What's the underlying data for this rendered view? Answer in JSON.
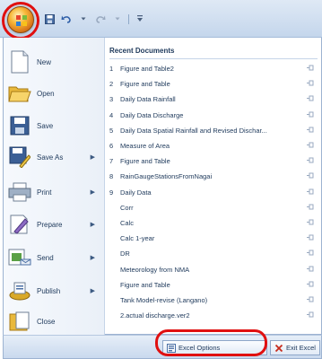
{
  "quick_access": {
    "save_icon": "save-icon",
    "undo_icon": "undo-icon",
    "redo_icon": "redo-icon",
    "customize_icon": "customize-arrow-icon"
  },
  "commands": [
    {
      "label": "New",
      "icon": "new-document-icon",
      "has_submenu": false
    },
    {
      "label": "Open",
      "icon": "open-folder-icon",
      "has_submenu": false
    },
    {
      "label": "Save",
      "icon": "save-disk-icon",
      "has_submenu": false
    },
    {
      "label": "Save As",
      "icon": "save-as-icon",
      "has_submenu": true
    },
    {
      "label": "Print",
      "icon": "printer-icon",
      "has_submenu": true
    },
    {
      "label": "Prepare",
      "icon": "prepare-icon",
      "has_submenu": true
    },
    {
      "label": "Send",
      "icon": "send-icon",
      "has_submenu": true
    },
    {
      "label": "Publish",
      "icon": "publish-icon",
      "has_submenu": true
    },
    {
      "label": "Close",
      "icon": "close-document-icon",
      "has_submenu": false
    }
  ],
  "recent": {
    "header": "Recent Documents",
    "items": [
      {
        "num": "1",
        "name": "Figure and Table2"
      },
      {
        "num": "2",
        "name": "Figure and Table"
      },
      {
        "num": "3",
        "name": "Daily Data Rainfall"
      },
      {
        "num": "4",
        "name": "Daily Data Discharge"
      },
      {
        "num": "5",
        "name": "Daily Data Spatial Rainfall and Revised Dischar..."
      },
      {
        "num": "6",
        "name": "Measure of Area"
      },
      {
        "num": "7",
        "name": "Figure and Table"
      },
      {
        "num": "8",
        "name": "RainGaugeStationsFromNagai"
      },
      {
        "num": "9",
        "name": "Daily Data"
      },
      {
        "num": "",
        "name": "Corr"
      },
      {
        "num": "",
        "name": "Calc"
      },
      {
        "num": "",
        "name": "Calc 1-year"
      },
      {
        "num": "",
        "name": "DR"
      },
      {
        "num": "",
        "name": "Meteorology from NMA"
      },
      {
        "num": "",
        "name": "Figure and Table"
      },
      {
        "num": "",
        "name": "Tank Model-revise (Langano)"
      },
      {
        "num": "",
        "name": "2.actual discharge.ver2"
      }
    ]
  },
  "bottom": {
    "options_label": "Excel Options",
    "exit_label": "Exit Excel"
  },
  "colors": {
    "highlight_ring": "#e01010",
    "text": "#1e395b"
  }
}
